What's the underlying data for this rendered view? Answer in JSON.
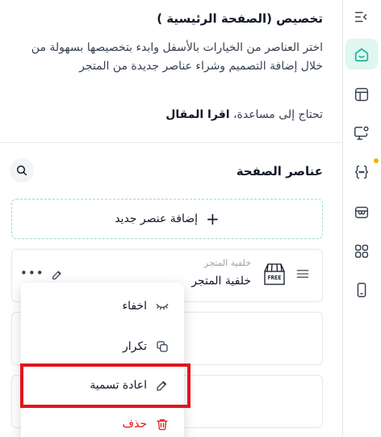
{
  "panel": {
    "title": "تخصيص (الصفحة الرئيسية )",
    "description": "اختر العناصر من الخيارات بالأسفل وابدء بتخصيصها بسهولة من خلال إضافة التصميم وشراء عناصر جديدة من المتجر",
    "help_text": "تحتاج إلى مساعدة،",
    "help_link": "اقرا المقال"
  },
  "elements_section": {
    "title": "عناصر الصفحة",
    "add_button": "إضافة عنصر جديد",
    "items": [
      {
        "subtitle": "خلفية المتجر",
        "name": "خلفية المتجر",
        "badge": "FREE"
      }
    ]
  },
  "context_menu": {
    "items": [
      {
        "label": "اخفاء",
        "icon": "eye-off-icon"
      },
      {
        "label": "تكرار",
        "icon": "copy-icon"
      },
      {
        "label": "اعادة تسمية",
        "icon": "pencil-icon"
      },
      {
        "label": "حذف",
        "icon": "trash-icon"
      }
    ]
  },
  "rail": {
    "icons": [
      "collapse-panel-icon",
      "home-icon",
      "layout-icon",
      "monitor-settings-icon",
      "code-icon",
      "store-icon",
      "grid-icon",
      "mobile-icon"
    ]
  },
  "colors": {
    "accent": "#19b394",
    "accent_light": "#dff6f1",
    "danger": "#e3141b",
    "notify": "#f5b000",
    "highlight": "#e3141b"
  }
}
